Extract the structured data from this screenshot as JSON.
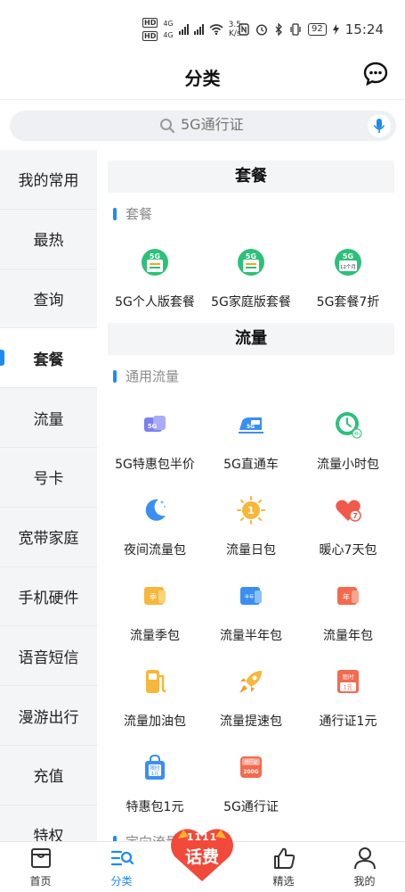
{
  "status_bar": {
    "hd1": "HD",
    "hd2": "HD",
    "net1": "4G",
    "net2": "4G",
    "speed_value": "3.5",
    "speed_unit": "K/s",
    "battery": "92",
    "time": "15:24"
  },
  "header": {
    "title": "分类"
  },
  "search": {
    "placeholder": "5G通行证"
  },
  "sidebar": {
    "items": [
      {
        "label": "我的常用"
      },
      {
        "label": "最热"
      },
      {
        "label": "查询"
      },
      {
        "label": "套餐"
      },
      {
        "label": "流量"
      },
      {
        "label": "号卡"
      },
      {
        "label": "宽带家庭"
      },
      {
        "label": "手机硬件"
      },
      {
        "label": "语音短信"
      },
      {
        "label": "漫游出行"
      },
      {
        "label": "充值"
      },
      {
        "label": "特权"
      }
    ],
    "active_index": 3
  },
  "content": {
    "section_plan": {
      "title": "套餐",
      "subtitle": "套餐",
      "tiles": [
        {
          "label": "5G个人版套餐",
          "icon": "5g-personal-plan-icon"
        },
        {
          "label": "5G家庭版套餐",
          "icon": "5g-family-plan-icon"
        },
        {
          "label": "5G套餐7折",
          "icon": "5g-plan-discount-icon"
        }
      ]
    },
    "section_data": {
      "title": "流量",
      "subtitle": "通用流量",
      "tiles": [
        {
          "label": "5G特惠包半价",
          "icon": "5g-card-icon"
        },
        {
          "label": "5G直通车",
          "icon": "5g-train-icon"
        },
        {
          "label": "流量小时包",
          "icon": "clock-4h-icon"
        },
        {
          "label": "夜间流量包",
          "icon": "moon-icon"
        },
        {
          "label": "流量日包",
          "icon": "sun-coin-icon"
        },
        {
          "label": "暖心7天包",
          "icon": "heart-7-icon"
        },
        {
          "label": "流量季包",
          "icon": "season-card-icon"
        },
        {
          "label": "流量半年包",
          "icon": "half-year-card-icon"
        },
        {
          "label": "流量年包",
          "icon": "year-card-icon"
        },
        {
          "label": "流量加油包",
          "icon": "fuel-pump-icon"
        },
        {
          "label": "流量提速包",
          "icon": "rocket-icon"
        },
        {
          "label": "通行证1元",
          "icon": "limited-ticket-icon"
        },
        {
          "label": "特惠包1元",
          "icon": "shopping-bag-icon"
        },
        {
          "label": "5G通行证",
          "icon": "5g-pass-icon"
        }
      ],
      "icon_texts": {
        "season": "季",
        "half_year": "半年",
        "year": "年",
        "limited": "限时",
        "one_yuan": "1元",
        "bag_limited": "限时",
        "bag_one_yuan": "1元",
        "pass_top": "通行证",
        "pass_bottom": "200G",
        "twelve_months": "12个月",
        "four_h": "4h"
      }
    },
    "next_subtitle_partial": "定向流量"
  },
  "bottom_nav": {
    "items": [
      {
        "label": "首页",
        "icon": "home-icon"
      },
      {
        "label": "分类",
        "icon": "category-icon"
      },
      {
        "label": "精选",
        "icon": "thumbs-up-icon"
      },
      {
        "label": "我的",
        "icon": "profile-icon"
      }
    ],
    "active_index": 1,
    "promo": {
      "top": "1111",
      "main": "话费"
    }
  },
  "colors": {
    "accent": "#1c8cf0",
    "sidebar_bg": "#f4f5f7",
    "promo": "#f24a3a"
  }
}
